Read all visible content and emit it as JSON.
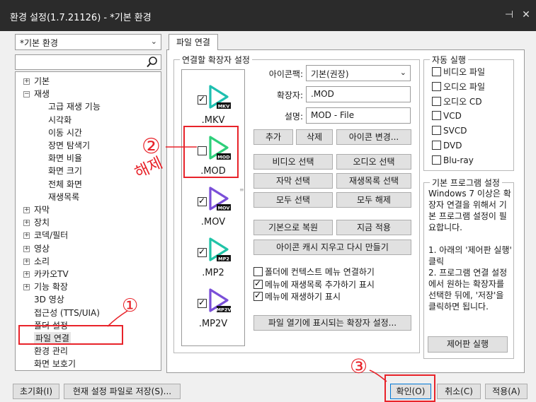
{
  "window": {
    "title": "환경 설정(1.7.21126) - *기본 환경",
    "pin_icon": "pin-icon",
    "close_icon": "close-icon"
  },
  "preset": {
    "selected": "*기본 환경"
  },
  "search": {
    "value": "",
    "icon": "search-icon"
  },
  "tree": [
    {
      "label": "기본",
      "level": 0,
      "expander": "+"
    },
    {
      "label": "재생",
      "level": 0,
      "expander": "−"
    },
    {
      "label": "고급 재생 기능",
      "level": 1
    },
    {
      "label": "시각화",
      "level": 1
    },
    {
      "label": "이동 시간",
      "level": 1
    },
    {
      "label": "장면 탐색기",
      "level": 1
    },
    {
      "label": "화면 비율",
      "level": 1
    },
    {
      "label": "화면 크기",
      "level": 1
    },
    {
      "label": "전체 화면",
      "level": 1
    },
    {
      "label": "재생목록",
      "level": 1
    },
    {
      "label": "자막",
      "level": 0,
      "expander": "+"
    },
    {
      "label": "장치",
      "level": 0,
      "expander": "+"
    },
    {
      "label": "코덱/필터",
      "level": 0,
      "expander": "+"
    },
    {
      "label": "영상",
      "level": 0,
      "expander": "+"
    },
    {
      "label": "소리",
      "level": 0,
      "expander": "+"
    },
    {
      "label": "카카오TV",
      "level": 0,
      "expander": "+"
    },
    {
      "label": "기능 확장",
      "level": 0,
      "expander": "+"
    },
    {
      "label": "3D 영상",
      "level": 0
    },
    {
      "label": "접근성 (TTS/UIA)",
      "level": 0
    },
    {
      "label": "폴더 설정",
      "level": 0
    },
    {
      "label": "파일 연결",
      "level": 0,
      "selected": true
    },
    {
      "label": "환경 관리",
      "level": 0
    },
    {
      "label": "화면 보호기",
      "level": 0
    }
  ],
  "tab": {
    "label": "파일 연결"
  },
  "ext_group": {
    "legend": "연결할 확장자 설정"
  },
  "extensions": [
    {
      "name": ".MKV",
      "badge": "MKV",
      "checked": true,
      "color": "#1fbfb0"
    },
    {
      "name": ".MOD",
      "badge": "MOD",
      "checked": false,
      "color": "#2ecf7a"
    },
    {
      "name": ".MOV",
      "badge": "MOV",
      "checked": true,
      "color": "#7a4fd8"
    },
    {
      "name": ".MP2",
      "badge": "MP2",
      "checked": true,
      "color": "#20c4a8"
    },
    {
      "name": ".MP2V",
      "badge": "MP2V",
      "checked": true,
      "color": "#7a4fd8"
    }
  ],
  "form": {
    "iconpack_label": "아이콘팩:",
    "iconpack_value": "기본(권장)",
    "ext_label": "확장자:",
    "ext_value": ".MOD",
    "desc_label": "설명:",
    "desc_value": "MOD - File"
  },
  "buttons": {
    "add": "추가",
    "delete": "삭제",
    "change_icon": "아이콘 변경...",
    "select_video": "비디오 선택",
    "select_audio": "오디오 선택",
    "select_subtitle": "자막 선택",
    "select_playlist": "재생목록 선택",
    "select_all": "모두 선택",
    "deselect_all": "모두 해제",
    "restore_default": "기본으로 복원",
    "apply_now": "지금 적용",
    "clear_icon_cache": "아이콘 캐시 지우고 다시 만들기",
    "ext_in_open_dialog": "파일 열기에 표시되는 확장자 설정...",
    "control_panel": "제어판 실행"
  },
  "context_options": [
    {
      "label": "폴더에 컨텍스트 메뉴 연결하기",
      "checked": false
    },
    {
      "label": "메뉴에 재생목록 추가하기 표시",
      "checked": true
    },
    {
      "label": "메뉴에 재생하기 표시",
      "checked": true
    }
  ],
  "autoplay": {
    "legend": "자동 실행",
    "items": [
      {
        "label": "비디오 파일",
        "checked": false
      },
      {
        "label": "오디오 파일",
        "checked": false
      },
      {
        "label": "오디오 CD",
        "checked": false
      },
      {
        "label": "VCD",
        "checked": false
      },
      {
        "label": "SVCD",
        "checked": false
      },
      {
        "label": "DVD",
        "checked": false
      },
      {
        "label": "Blu-ray",
        "checked": false
      }
    ]
  },
  "default_program": {
    "legend": "기본 프로그램 설정",
    "text": "Windows 7 이상은 확장자 연결을 위해서 기본 프로그램 설정이 필요합니다.\n\n1. 아래의 '제어판 실행' 클릭\n2. 프로그램 연결 설정에서 원하는 확장자를 선택한 뒤에, '저장'을 클릭하면 됩니다."
  },
  "footer": {
    "reset": "초기화(I)",
    "save_to_file": "현재 설정 파일로 저장(S)...",
    "ok": "확인(O)",
    "cancel": "취소(C)",
    "apply": "적용(A)"
  },
  "annotations": {
    "step1": "①",
    "step2": "②",
    "step3": "③",
    "uncheck_note": "해제",
    "color": "#e8232a"
  }
}
